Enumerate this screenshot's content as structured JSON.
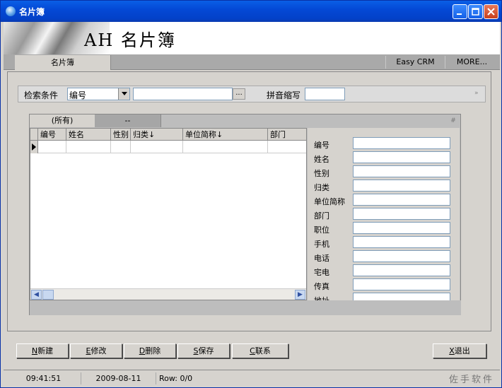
{
  "window": {
    "title": "名片簿",
    "banner_title": "AH 名片簿"
  },
  "topbar": {
    "tab_label": "名片簿",
    "buttons": [
      "Easy CRM",
      "MORE..."
    ]
  },
  "search": {
    "criteria_label": "检索条件",
    "criteria_value": "编号",
    "keyword_value": "",
    "browse_label": "...",
    "pinyin_label": "拼音缩写",
    "pinyin_value": "",
    "collapse_label": "»"
  },
  "inner_tabs": [
    "(所有)",
    "--"
  ],
  "inner_tab_pin": "#",
  "grid": {
    "columns": [
      "编号",
      "姓名",
      "性别",
      "归类↓",
      "单位简称↓",
      "部门"
    ]
  },
  "detail": {
    "fields": [
      {
        "label": "编号",
        "value": ""
      },
      {
        "label": "姓名",
        "value": ""
      },
      {
        "label": "性别",
        "value": ""
      },
      {
        "label": "归类",
        "value": ""
      },
      {
        "label": "单位简称",
        "value": ""
      },
      {
        "label": "部门",
        "value": ""
      },
      {
        "label": "职位",
        "value": ""
      },
      {
        "label": "手机",
        "value": ""
      },
      {
        "label": "电话",
        "value": ""
      },
      {
        "label": "宅电",
        "value": ""
      },
      {
        "label": "传真",
        "value": ""
      },
      {
        "label": "地址",
        "value": ""
      }
    ]
  },
  "actions": [
    {
      "key": "N",
      "label": "新建"
    },
    {
      "key": "E",
      "label": "修改"
    },
    {
      "key": "D",
      "label": "删除"
    },
    {
      "key": "S",
      "label": "保存"
    },
    {
      "key": "C",
      "label": "联系"
    }
  ],
  "exit": {
    "key": "X",
    "label": "退出"
  },
  "status": {
    "time": "09:41:51",
    "date": "2009-08-11",
    "row": "Row: 0/0",
    "brand": "佐手软件"
  },
  "colors": {
    "titlebar": "#0449d6",
    "face": "#d6d3ce",
    "field_border": "#7f9db9"
  }
}
